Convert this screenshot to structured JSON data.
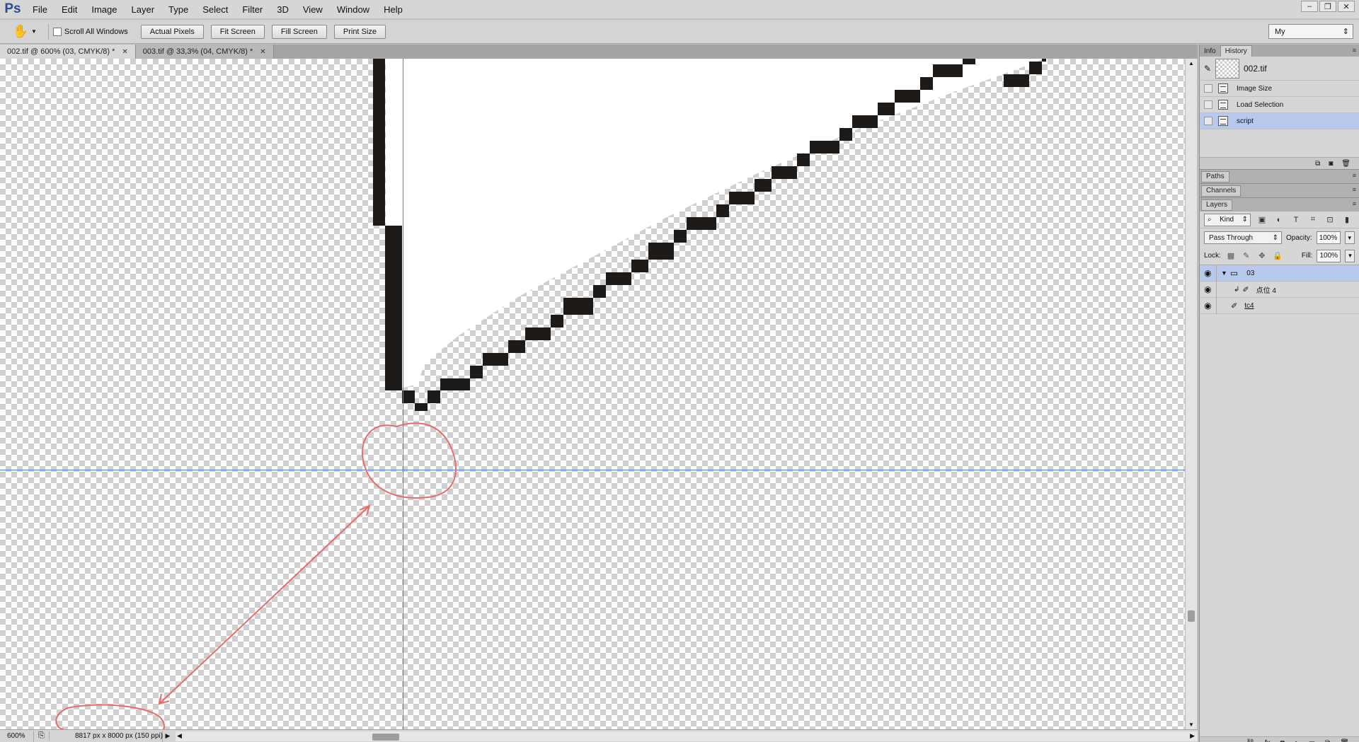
{
  "app": {
    "logo": "Ps"
  },
  "menu": [
    "File",
    "Edit",
    "Image",
    "Layer",
    "Type",
    "Select",
    "Filter",
    "3D",
    "View",
    "Window",
    "Help"
  ],
  "window_controls": {
    "minimize": "–",
    "restore": "❐",
    "close": "✕"
  },
  "options_bar": {
    "scroll_all_windows": "Scroll All Windows",
    "scroll_all_checked": false,
    "actual_pixels": "Actual Pixels",
    "fit_screen": "Fit Screen",
    "fill_screen": "Fill Screen",
    "print_size": "Print Size",
    "workspace": "My"
  },
  "tabs": [
    {
      "label": "002.tif @ 600% (03, CMYK/8) *",
      "active": true
    },
    {
      "label": "003.tif @ 33,3% (04, CMYK/8) *",
      "active": false
    }
  ],
  "status": {
    "zoom": "600%",
    "doc_info": "8817 px x 8000 px (150 ppi)"
  },
  "history_panel": {
    "tabs": [
      "Info",
      "History"
    ],
    "active_tab": "History",
    "snapshot": "002.tif",
    "steps": [
      {
        "label": "Image Size",
        "selected": false
      },
      {
        "label": "Load Selection",
        "selected": false
      },
      {
        "label": "script",
        "selected": true
      }
    ]
  },
  "paths_panel": {
    "title": "Paths"
  },
  "channels_panel": {
    "title": "Channels"
  },
  "layers_panel": {
    "title": "Layers",
    "filter_kind": "Kind",
    "blend_mode": "Pass Through",
    "opacity_label": "Opacity:",
    "opacity": "100%",
    "lock_label": "Lock:",
    "fill_label": "Fill:",
    "fill": "100%",
    "layers": [
      {
        "name": "03",
        "type": "group",
        "selected": true
      },
      {
        "name": "点位 4",
        "type": "clipped",
        "selected": false
      },
      {
        "name": "tc4",
        "type": "layer",
        "selected": false
      }
    ]
  }
}
